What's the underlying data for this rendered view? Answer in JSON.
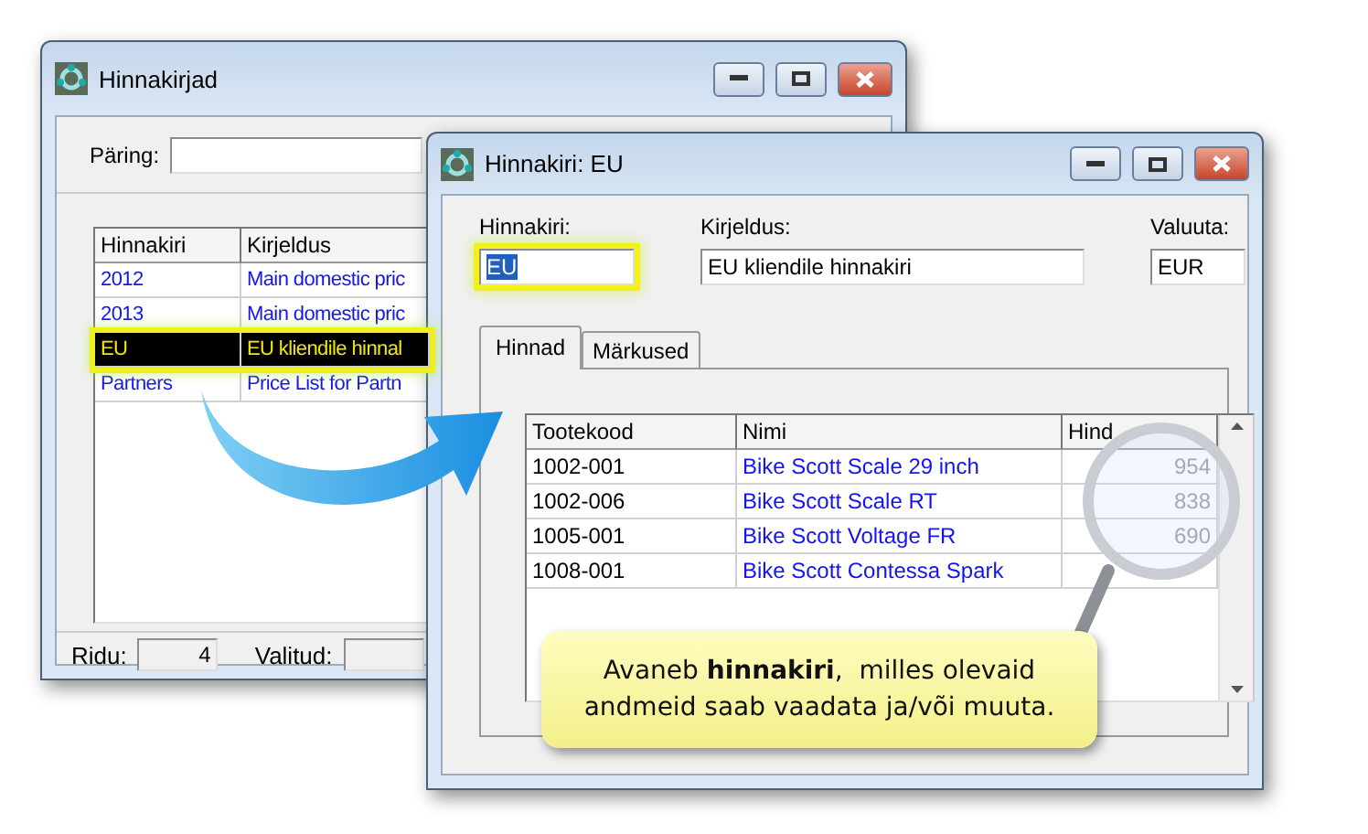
{
  "list_window": {
    "title": "Hinnakirjad",
    "query_label": "Päring:",
    "columns": [
      "Hinnakiri",
      "Kirjeldus"
    ],
    "rows": [
      {
        "cells": [
          "2012",
          "Main domestic pric"
        ],
        "selected": false
      },
      {
        "cells": [
          "2013",
          "Main domestic pric"
        ],
        "selected": false
      },
      {
        "cells": [
          "EU",
          "EU kliendile hinnal"
        ],
        "selected": true
      },
      {
        "cells": [
          "Partners",
          "Price List for Partn"
        ],
        "selected": false
      }
    ],
    "status": [
      {
        "label": "Ridu:",
        "value": "4"
      },
      {
        "label": "Valitud:"
      }
    ]
  },
  "detail_window": {
    "title": "Hinnakiri: EU",
    "fields": [
      {
        "label": "Hinnakiri:",
        "value": "EU",
        "highlighted": true
      },
      {
        "label": "Kirjeldus:",
        "value": "EU kliendile hinnakiri",
        "highlighted": false
      },
      {
        "label": "Valuuta:",
        "value": "EUR",
        "highlighted": false
      }
    ],
    "tabs": [
      {
        "label": "Hinnad",
        "selected": true
      },
      {
        "label": "Märkused",
        "selected": false
      }
    ],
    "columns": [
      "Tootekood",
      "Nimi",
      "Hind"
    ],
    "rows": [
      {
        "code": "1002-001",
        "name": "Bike Scott Scale 29 inch",
        "price": "954"
      },
      {
        "code": "1002-006",
        "name": "Bike Scott Scale RT",
        "price": "838"
      },
      {
        "code": "1005-001",
        "name": "Bike Scott Voltage FR",
        "price": "690"
      },
      {
        "code": "1008-001",
        "name": "Bike Scott Contessa Spark"
      }
    ]
  },
  "callout": {
    "lines": [
      "Avaneb **hinnakiri**,  milles olevaid",
      "andmeid saab vaadata ja/või muuta."
    ]
  }
}
